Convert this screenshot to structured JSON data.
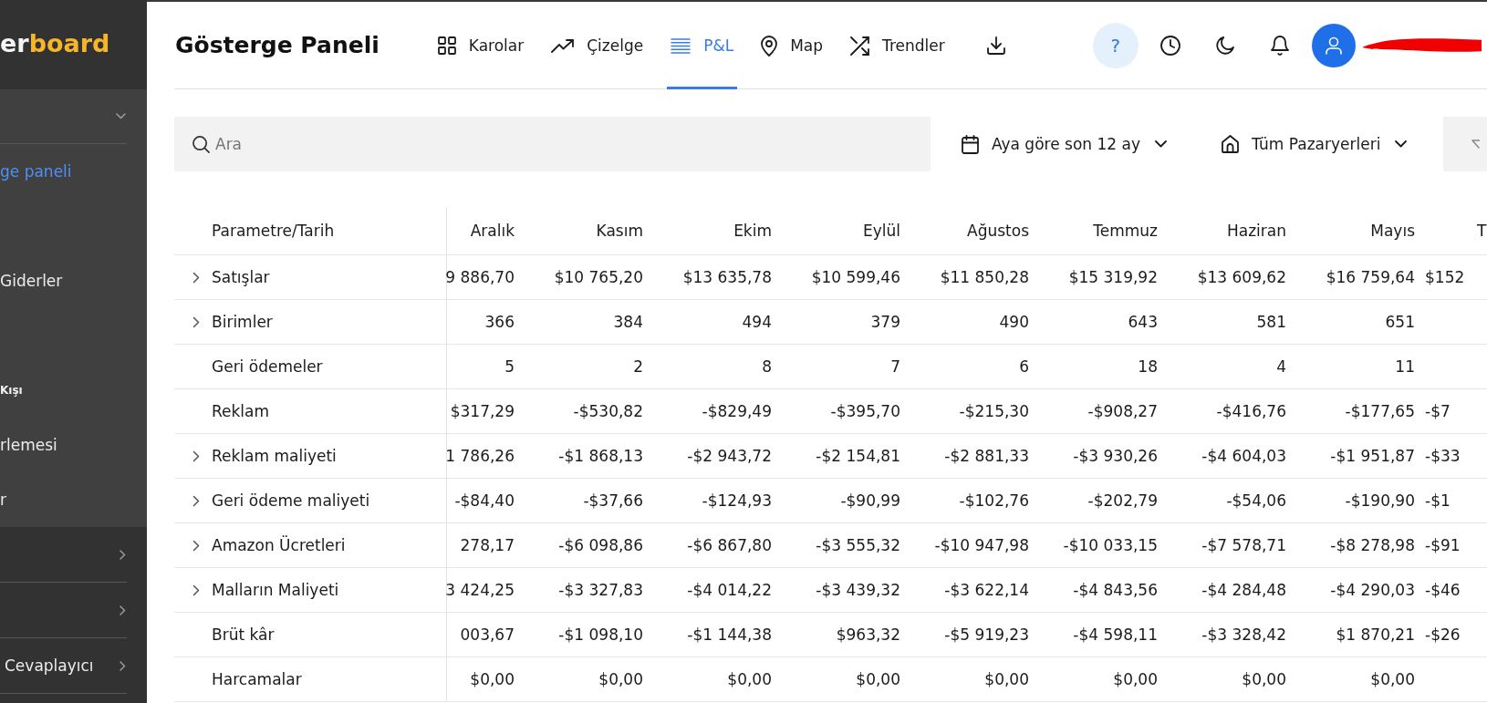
{
  "sidebar": {
    "logo": {
      "lead": "er",
      "accent": "board"
    },
    "groups": [
      {
        "expanded": true,
        "items": [
          {
            "kind": "link",
            "label": "ge paneli",
            "selected": true
          },
          {
            "kind": "link",
            "label": "Giderler",
            "selected": false
          },
          {
            "kind": "section",
            "label": "Kışı"
          },
          {
            "kind": "link",
            "label": "rlemesi",
            "selected": false
          },
          {
            "kind": "link",
            "label": "r",
            "selected": false
          }
        ]
      },
      {
        "expanded": false
      },
      {
        "expanded": false
      },
      {
        "expanded": false,
        "label": "Cevaplayıcı"
      }
    ]
  },
  "header": {
    "title": "Gösterge Paneli",
    "tabs": [
      {
        "kind": "tiles",
        "label": "Karolar",
        "selected": false
      },
      {
        "kind": "chart",
        "label": "Çizelge",
        "selected": false
      },
      {
        "kind": "table",
        "label": "P&L",
        "selected": true
      },
      {
        "kind": "map",
        "label": "Map",
        "selected": false
      },
      {
        "kind": "trends",
        "label": "Trendler",
        "selected": false
      }
    ],
    "actions": [
      {
        "kind": "help",
        "symbol": "?",
        "active": true
      },
      {
        "kind": "history",
        "active": false
      },
      {
        "kind": "theme",
        "active": false
      },
      {
        "kind": "notifications",
        "active": false
      }
    ]
  },
  "filters": {
    "search": {
      "placeholder": "Ara"
    },
    "date_range": {
      "value": "Aya göre son 12 ay"
    },
    "marketplace": {
      "value": "Tüm Pazaryerleri"
    }
  },
  "table": {
    "columns": [
      "Parametre/Tarih",
      "Aralık",
      "Kasım",
      "Ekim",
      "Eylül",
      "Ağustos",
      "Temmuz",
      "Haziran",
      "Mayıs",
      "T"
    ],
    "rows": [
      {
        "expandable": true,
        "cells": [
          "Satışlar",
          "9 886,70",
          "$10 765,20",
          "$13 635,78",
          "$10 599,46",
          "$11 850,28",
          "$15 319,92",
          "$13 609,62",
          "$16 759,64",
          "$152"
        ]
      },
      {
        "expandable": true,
        "cells": [
          "Birimler",
          "366",
          "384",
          "494",
          "379",
          "490",
          "643",
          "581",
          "651"
        ]
      },
      {
        "expandable": false,
        "cells": [
          "Geri ödemeler",
          "5",
          "2",
          "8",
          "7",
          "6",
          "18",
          "4",
          "11"
        ]
      },
      {
        "expandable": false,
        "cells": [
          "Reklam",
          "$317,29",
          "-$530,82",
          "-$829,49",
          "-$395,70",
          "-$215,30",
          "-$908,27",
          "-$416,76",
          "-$177,65",
          "-$7"
        ]
      },
      {
        "expandable": true,
        "cells": [
          "Reklam maliyeti",
          "1 786,26",
          "-$1 868,13",
          "-$2 943,72",
          "-$2 154,81",
          "-$2 881,33",
          "-$3 930,26",
          "-$4 604,03",
          "-$1 951,87",
          "-$33"
        ]
      },
      {
        "expandable": true,
        "cells": [
          "Geri ödeme maliyeti",
          "-$84,40",
          "-$37,66",
          "-$124,93",
          "-$90,99",
          "-$102,76",
          "-$202,79",
          "-$54,06",
          "-$190,90",
          "-$1"
        ]
      },
      {
        "expandable": true,
        "cells": [
          "Amazon Ücretleri",
          "278,17",
          "-$6 098,86",
          "-$6 867,80",
          "-$3 555,32",
          "-$10 947,98",
          "-$10 033,15",
          "-$7 578,71",
          "-$8 278,98",
          "-$91"
        ]
      },
      {
        "expandable": true,
        "cells": [
          "Malların Maliyeti",
          "3 424,25",
          "-$3 327,83",
          "-$4 014,22",
          "-$3 439,32",
          "-$3 622,14",
          "-$4 843,56",
          "-$4 284,48",
          "-$4 290,03",
          "-$46"
        ]
      },
      {
        "expandable": false,
        "cells": [
          "Brüt kâr",
          "003,67",
          "-$1 098,10",
          "-$1 144,38",
          "$963,32",
          "-$5 919,23",
          "-$4 598,11",
          "-$3 328,42",
          "$1 870,21",
          "-$26"
        ]
      },
      {
        "expandable": false,
        "cells": [
          "Harcamalar",
          "$0,00",
          "$0,00",
          "$0,00",
          "$0,00",
          "$0,00",
          "$0,00",
          "$0,00",
          "$0,00"
        ]
      }
    ]
  }
}
